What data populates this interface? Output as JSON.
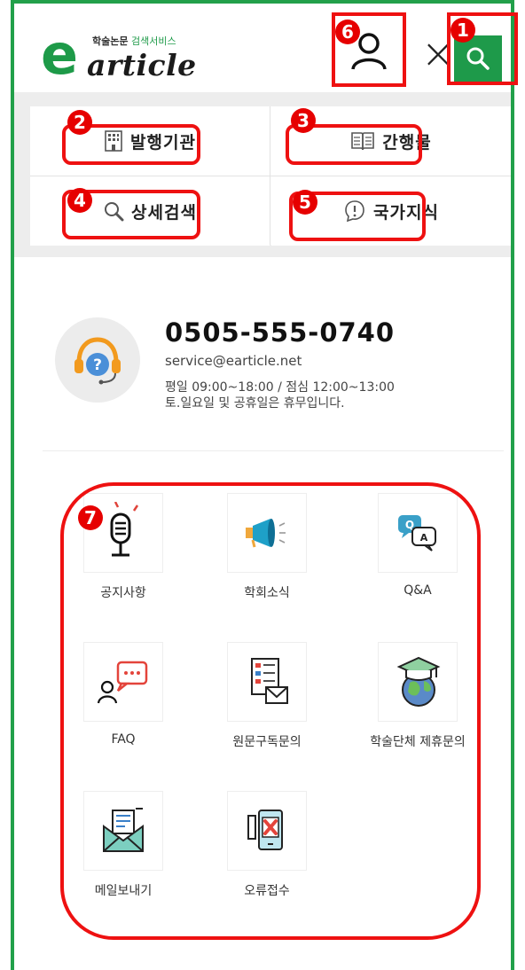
{
  "brand": {
    "logo_letter": "e",
    "logo_word": "article",
    "tagline_bold": "학술논문",
    "tagline_light": "검색서비스",
    "accent_color": "#1d9a48"
  },
  "header": {
    "user_icon": "user-icon",
    "close_symbol": "×",
    "search_icon": "search-icon"
  },
  "menu": [
    {
      "label": "발행기관",
      "icon": "building-icon"
    },
    {
      "label": "간행물",
      "icon": "book-icon"
    },
    {
      "label": "상세검색",
      "icon": "magnifier-icon"
    },
    {
      "label": "국가지식",
      "icon": "knowledge-icon"
    }
  ],
  "contact": {
    "phone": "0505-555-0740",
    "email": "service@earticle.net",
    "hours_line1": "평일 09:00~18:00 / 점심 12:00~13:00",
    "hours_line2": "토.일요일 및 공휴일은 휴무입니다."
  },
  "services": [
    {
      "label": "공지사항",
      "icon": "microphone-icon"
    },
    {
      "label": "학회소식",
      "icon": "megaphone-icon"
    },
    {
      "label": "Q&A",
      "icon": "qa-bubbles-icon"
    },
    {
      "label": "FAQ",
      "icon": "faq-chat-icon"
    },
    {
      "label": "원문구독문의",
      "icon": "document-mail-icon"
    },
    {
      "label": "학술단체 제휴문의",
      "icon": "globe-graduation-icon"
    },
    {
      "label": "메일보내기",
      "icon": "envelope-icon"
    },
    {
      "label": "오류접수",
      "icon": "error-phone-icon"
    }
  ],
  "annotations": [
    "1",
    "2",
    "3",
    "4",
    "5",
    "6",
    "7"
  ],
  "annotation_color": "#ee1111"
}
